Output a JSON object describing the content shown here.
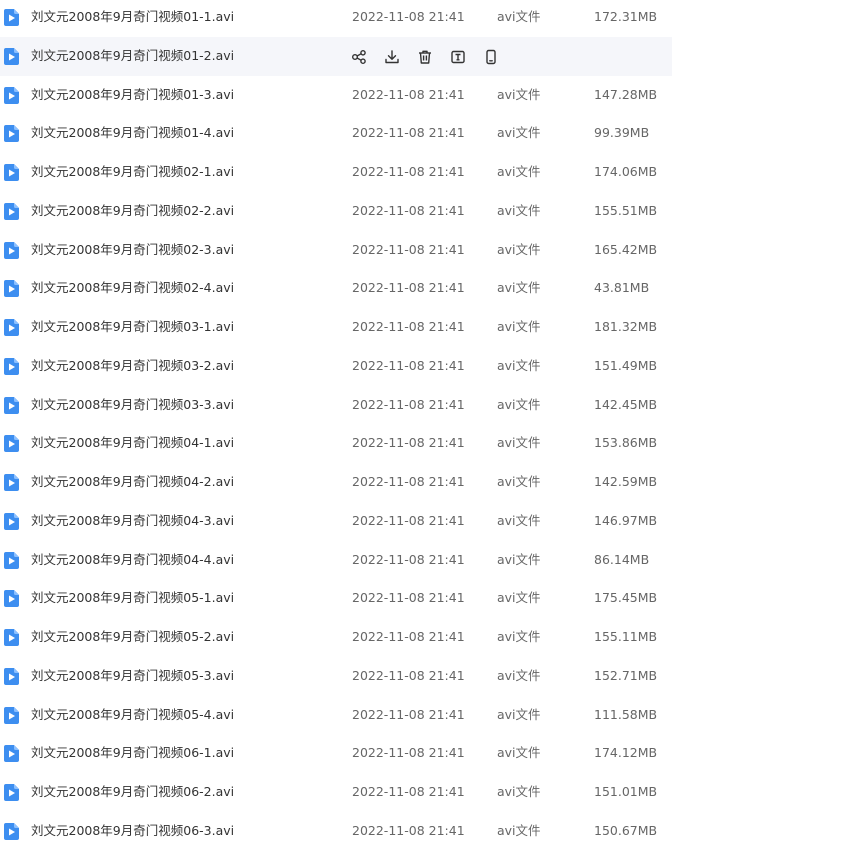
{
  "colors": {
    "icon_blue": "#3d8ef0",
    "row_hover_bg": "#f5f6fa",
    "action_icon": "#333333"
  },
  "hovered_row_index": 1,
  "hover_actions": [
    {
      "name": "share-icon"
    },
    {
      "name": "download-icon"
    },
    {
      "name": "delete-icon"
    },
    {
      "name": "rename-icon"
    },
    {
      "name": "mobile-icon"
    }
  ],
  "files": [
    {
      "name": "刘文元2008年9月奇门视频01-1.avi",
      "time": "2022-11-08 21:41",
      "type": "avi文件",
      "size": "172.31MB"
    },
    {
      "name": "刘文元2008年9月奇门视频01-2.avi",
      "time": "",
      "type": "",
      "size": ""
    },
    {
      "name": "刘文元2008年9月奇门视频01-3.avi",
      "time": "2022-11-08 21:41",
      "type": "avi文件",
      "size": "147.28MB"
    },
    {
      "name": "刘文元2008年9月奇门视频01-4.avi",
      "time": "2022-11-08 21:41",
      "type": "avi文件",
      "size": "99.39MB"
    },
    {
      "name": "刘文元2008年9月奇门视频02-1.avi",
      "time": "2022-11-08 21:41",
      "type": "avi文件",
      "size": "174.06MB"
    },
    {
      "name": "刘文元2008年9月奇门视频02-2.avi",
      "time": "2022-11-08 21:41",
      "type": "avi文件",
      "size": "155.51MB"
    },
    {
      "name": "刘文元2008年9月奇门视频02-3.avi",
      "time": "2022-11-08 21:41",
      "type": "avi文件",
      "size": "165.42MB"
    },
    {
      "name": "刘文元2008年9月奇门视频02-4.avi",
      "time": "2022-11-08 21:41",
      "type": "avi文件",
      "size": "43.81MB"
    },
    {
      "name": "刘文元2008年9月奇门视频03-1.avi",
      "time": "2022-11-08 21:41",
      "type": "avi文件",
      "size": "181.32MB"
    },
    {
      "name": "刘文元2008年9月奇门视频03-2.avi",
      "time": "2022-11-08 21:41",
      "type": "avi文件",
      "size": "151.49MB"
    },
    {
      "name": "刘文元2008年9月奇门视频03-3.avi",
      "time": "2022-11-08 21:41",
      "type": "avi文件",
      "size": "142.45MB"
    },
    {
      "name": "刘文元2008年9月奇门视频04-1.avi",
      "time": "2022-11-08 21:41",
      "type": "avi文件",
      "size": "153.86MB"
    },
    {
      "name": "刘文元2008年9月奇门视频04-2.avi",
      "time": "2022-11-08 21:41",
      "type": "avi文件",
      "size": "142.59MB"
    },
    {
      "name": "刘文元2008年9月奇门视频04-3.avi",
      "time": "2022-11-08 21:41",
      "type": "avi文件",
      "size": "146.97MB"
    },
    {
      "name": "刘文元2008年9月奇门视频04-4.avi",
      "time": "2022-11-08 21:41",
      "type": "avi文件",
      "size": "86.14MB"
    },
    {
      "name": "刘文元2008年9月奇门视频05-1.avi",
      "time": "2022-11-08 21:41",
      "type": "avi文件",
      "size": "175.45MB"
    },
    {
      "name": "刘文元2008年9月奇门视频05-2.avi",
      "time": "2022-11-08 21:41",
      "type": "avi文件",
      "size": "155.11MB"
    },
    {
      "name": "刘文元2008年9月奇门视频05-3.avi",
      "time": "2022-11-08 21:41",
      "type": "avi文件",
      "size": "152.71MB"
    },
    {
      "name": "刘文元2008年9月奇门视频05-4.avi",
      "time": "2022-11-08 21:41",
      "type": "avi文件",
      "size": "111.58MB"
    },
    {
      "name": "刘文元2008年9月奇门视频06-1.avi",
      "time": "2022-11-08 21:41",
      "type": "avi文件",
      "size": "174.12MB"
    },
    {
      "name": "刘文元2008年9月奇门视频06-2.avi",
      "time": "2022-11-08 21:41",
      "type": "avi文件",
      "size": "151.01MB"
    },
    {
      "name": "刘文元2008年9月奇门视频06-3.avi",
      "time": "2022-11-08 21:41",
      "type": "avi文件",
      "size": "150.67MB"
    }
  ]
}
